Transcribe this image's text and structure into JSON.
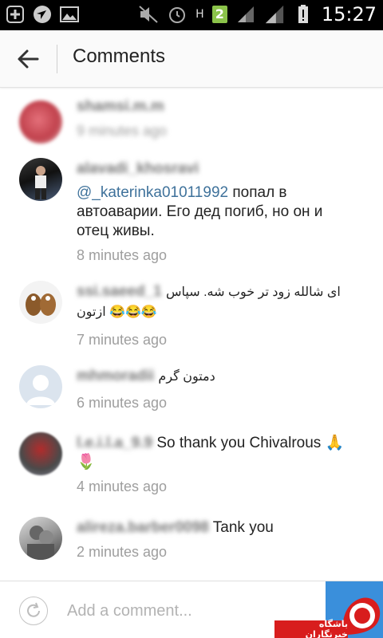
{
  "status_bar": {
    "time": "15:27",
    "badge_count": "2",
    "network": "H"
  },
  "header": {
    "title": "Comments"
  },
  "comments": [
    {
      "username": "shamsi.m.m",
      "text": "",
      "time_ago": "9 minutes ago"
    },
    {
      "username": "alavadi_khosravi",
      "mention": "@_katerinka01011992",
      "text": " попал в автоаварии. Его дед погиб, но он и отец живы.",
      "time_ago": "8 minutes ago"
    },
    {
      "username": "ssi.saeed_1",
      "text": "ای شالله زود تر خوب شه. سپاس ازتون 😂😂😂",
      "time_ago": "7 minutes ago"
    },
    {
      "username": "mhmoradii",
      "text": "دمتون گرم",
      "time_ago": "6 minutes ago"
    },
    {
      "username": "l.e.i.l.a_9.9",
      "text": " So thank you Chivalrous 🙏 🌷",
      "time_ago": "4 minutes ago"
    },
    {
      "username": "alireza.barber0098",
      "text": " Tank you",
      "time_ago": "2 minutes ago"
    }
  ],
  "footer": {
    "input_placeholder": "Add a comment..."
  },
  "watermark": {
    "text": "باشگاه خبرنگاران"
  },
  "colors": {
    "username": "#3f729b",
    "time": "#9e9e9e",
    "send": "#3a8fdb"
  }
}
